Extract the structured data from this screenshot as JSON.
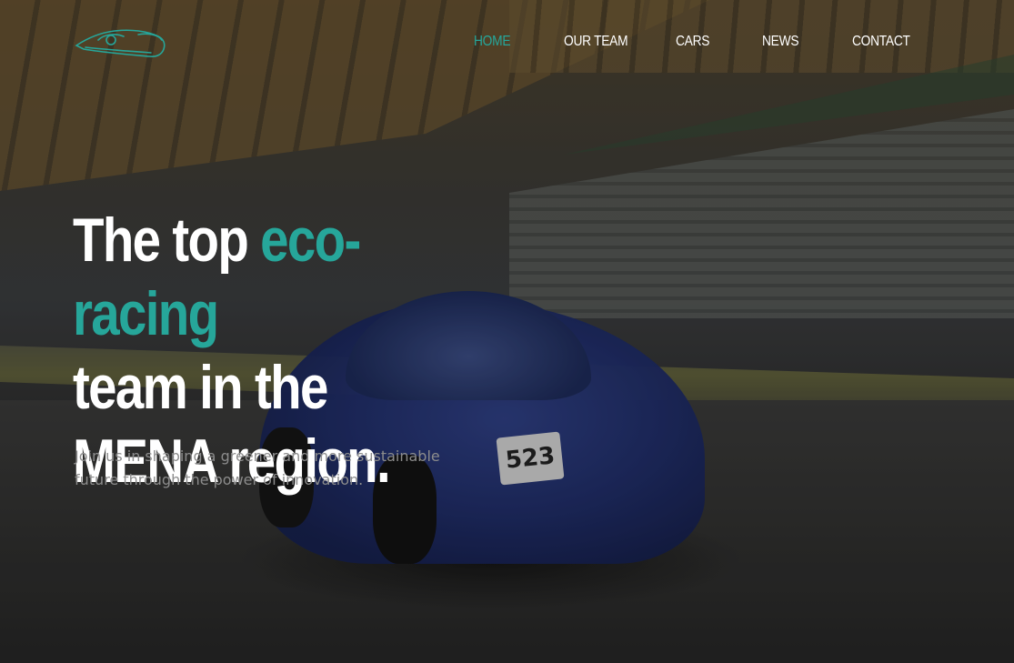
{
  "brand": {
    "logo_icon": "race-car-logo-icon",
    "accent_color": "#26a69a"
  },
  "nav": {
    "items": [
      {
        "label": "HOME",
        "active": true
      },
      {
        "label": "OUR TEAM",
        "active": false
      },
      {
        "label": "CARS",
        "active": false
      },
      {
        "label": "NEWS",
        "active": false
      },
      {
        "label": "CONTACT",
        "active": false
      }
    ]
  },
  "hero": {
    "headline_part1": "The top ",
    "headline_accent": "eco-racing",
    "headline_part2": "team in the MENA region.",
    "subtitle": "Join us in shaping a greener and more sustainable future through the power of innovation.",
    "background_image": "blue-eco-race-car-on-track",
    "car_number": "523"
  }
}
